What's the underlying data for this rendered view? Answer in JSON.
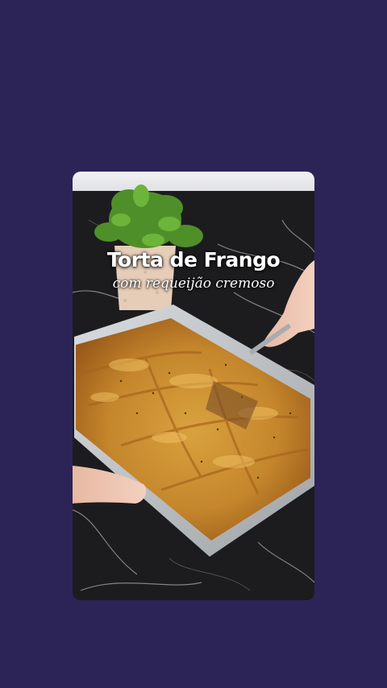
{
  "video": {
    "title": "Torta de Frango",
    "subtitle": "com requeijão cremoso"
  },
  "colors": {
    "background": "#2c2456",
    "countertop": "#1b1b1d",
    "pie_crust": "#c98a2c",
    "pan": "#bfc3c6"
  }
}
